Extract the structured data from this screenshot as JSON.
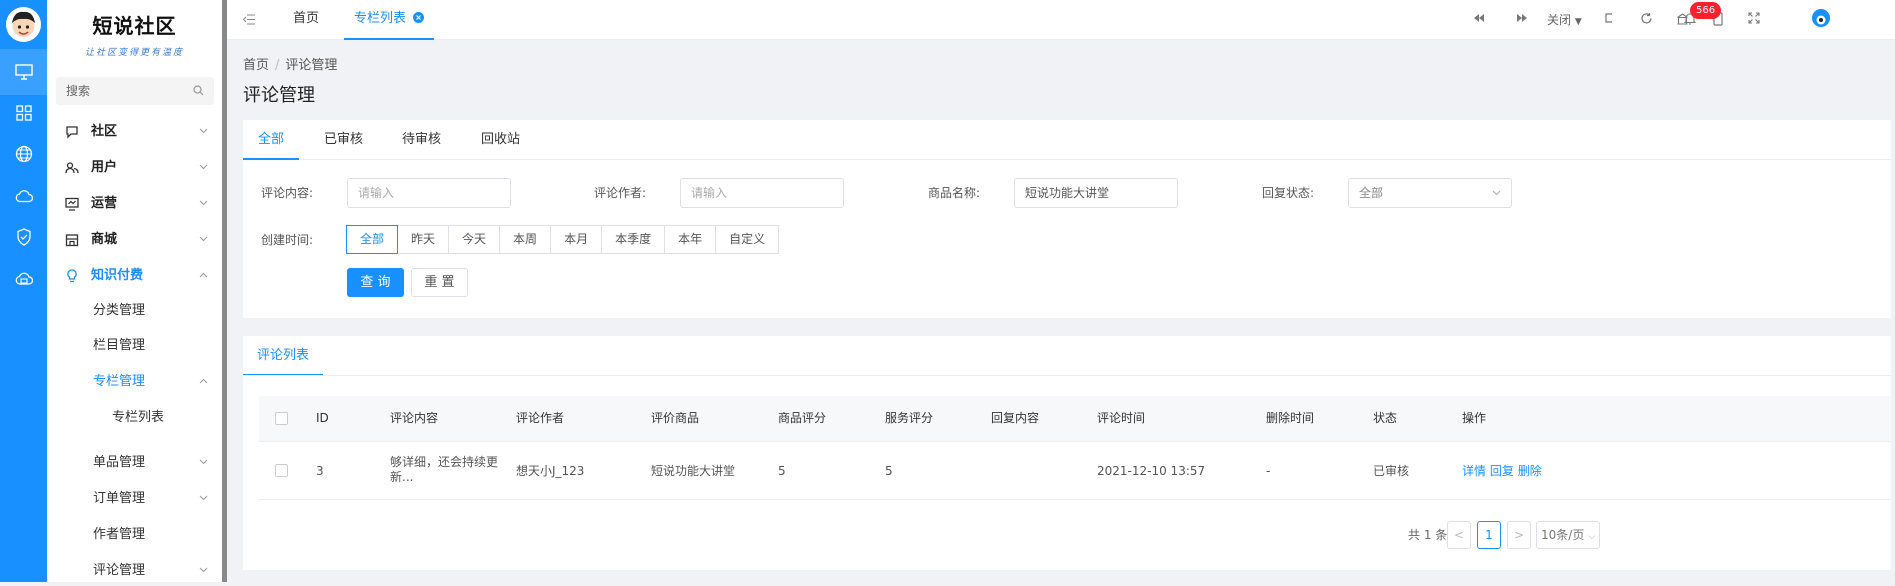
{
  "logo": {
    "title": "短说社区",
    "subtitle": "让社区变得更有温度"
  },
  "search": {
    "placeholder": "搜索"
  },
  "rail_icons": [
    "monitor-icon",
    "grid-icon",
    "globe-icon",
    "cloud-icon",
    "shield-check-icon",
    "cloud-server-icon"
  ],
  "menu": {
    "community": "社区",
    "users": "用户",
    "operations": "运营",
    "mall": "商城",
    "knowledge": "知识付费",
    "category_mgmt": "分类管理",
    "column_mgmt": "栏目管理",
    "special_mgmt": "专栏管理",
    "special_list": "专栏列表",
    "item_mgmt": "单品管理",
    "order_mgmt": "订单管理",
    "author_mgmt": "作者管理",
    "comment_mgmt": "评论管理"
  },
  "topbar": {
    "tab_home": "首页",
    "tab_special_list": "专栏列表",
    "close_label": "关闭",
    "notification_count": "566"
  },
  "breadcrumb": {
    "home": "首页",
    "sep": "/",
    "current": "评论管理"
  },
  "page_title": "评论管理",
  "filter_tabs": [
    "全部",
    "已审核",
    "待审核",
    "回收站"
  ],
  "filters": {
    "content_label": "评论内容:",
    "content_placeholder": "请输入",
    "author_label": "评论作者:",
    "author_placeholder": "请输入",
    "product_label": "商品名称:",
    "product_value": "短说功能大讲堂",
    "reply_label": "回复状态:",
    "reply_value": "全部",
    "time_label": "创建时间:",
    "time_options": [
      "全部",
      "昨天",
      "今天",
      "本周",
      "本月",
      "本季度",
      "本年",
      "自定义"
    ],
    "search_button": "查 询",
    "reset_button": "重 置"
  },
  "list": {
    "tab": "评论列表",
    "headers": [
      "ID",
      "评论内容",
      "评论作者",
      "评价商品",
      "商品评分",
      "服务评分",
      "回复内容",
      "评论时间",
      "删除时间",
      "状态",
      "操作"
    ],
    "rows": [
      {
        "id": "3",
        "content_line1": "够详细，还会持续更",
        "content_line2": "新...",
        "author": "想天小J_123",
        "product": "短说功能大讲堂",
        "product_score": "5",
        "service_score": "5",
        "reply": "",
        "time": "2021-12-10 13:57",
        "deleted": "-",
        "status": "已审核",
        "actions": [
          "详情",
          "回复",
          "删除"
        ]
      }
    ]
  },
  "pagination": {
    "total": "共 1 条",
    "prev": "<",
    "page": "1",
    "next": ">",
    "size": "10条/页"
  },
  "colors": {
    "accent": "#1890ff",
    "rail": "#1890ff",
    "badge": "#f5222d"
  }
}
